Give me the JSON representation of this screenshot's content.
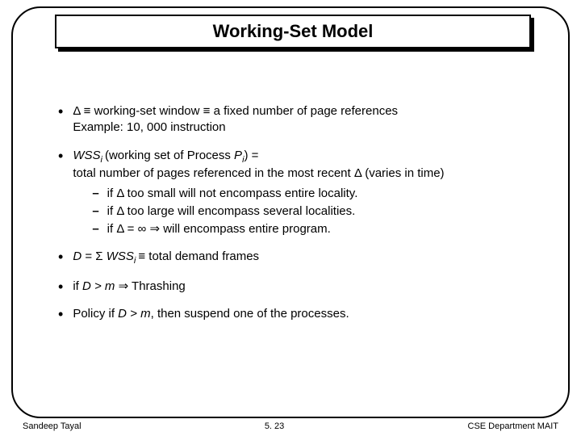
{
  "title": "Working-Set Model",
  "b1": {
    "line1a": "Δ ≡ working-set window ≡ a fixed number of page references",
    "line2": "Example:  10, 000 instruction"
  },
  "b2": {
    "prefix": "WSS",
    "sub": "i ",
    "mid": "(working set of Process ",
    "p": "P",
    "psub": "i",
    "after": ") =",
    "line2": "total number of pages referenced in the most recent Δ (varies in time)",
    "s1": "if Δ too small will not encompass entire locality.",
    "s2": "if Δ too large will encompass several localities.",
    "s3": "if Δ = ∞ ⇒ will encompass entire program."
  },
  "b3": {
    "a": "D",
    "b": " = Σ ",
    "c": "WSS",
    "csub": "i ",
    "d": "≡ total demand frames"
  },
  "b4": {
    "a": "if ",
    "b": "D > m",
    "c": " ⇒ Thrashing"
  },
  "b5": {
    "a": "Policy if ",
    "b": "D > m",
    "c": ", then suspend one of the processes."
  },
  "footer": {
    "left": "Sandeep Tayal",
    "center": "5. 23",
    "right": "CSE Department MAIT"
  }
}
